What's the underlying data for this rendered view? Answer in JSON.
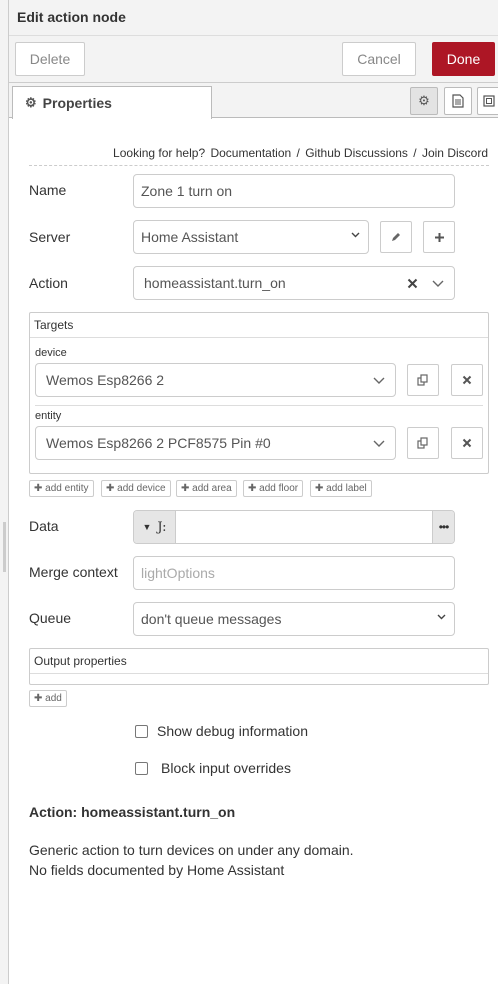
{
  "title": "Edit action node",
  "buttons": {
    "delete": "Delete",
    "cancel": "Cancel",
    "done": "Done"
  },
  "tabs": {
    "properties": "Properties"
  },
  "help": {
    "prefix": "Looking for help?",
    "documentation": "Documentation",
    "sep": "/",
    "github": "Github Discussions",
    "discord": "Join Discord"
  },
  "form": {
    "name_label": "Name",
    "name_value": "Zone 1 turn on",
    "server_label": "Server",
    "server_value": "Home Assistant",
    "action_label": "Action",
    "action_value": "homeassistant.turn_on",
    "targets_label": "Targets",
    "device_label": "device",
    "device_value": "Wemos Esp8266 2",
    "entity_label": "entity",
    "entity_value": "Wemos Esp8266 2 PCF8575 Pin #0",
    "add_buttons": [
      "add entity",
      "add device",
      "add area",
      "add floor",
      "add label"
    ],
    "data_label": "Data",
    "data_type_glyph": "J:",
    "merge_label": "Merge context",
    "merge_placeholder": "lightOptions",
    "queue_label": "Queue",
    "queue_value": "don't queue messages",
    "output_label": "Output properties",
    "add_label": "add",
    "debug_label": "Show debug information",
    "block_label": "Block input overrides"
  },
  "info": {
    "title": "Action: homeassistant.turn_on",
    "line1": "Generic action to turn devices on under any domain.",
    "line2": "No fields documented by Home Assistant"
  },
  "colors": {
    "done": "#ad1625",
    "border": "#cccccc",
    "panel": "#f3f3f3"
  }
}
